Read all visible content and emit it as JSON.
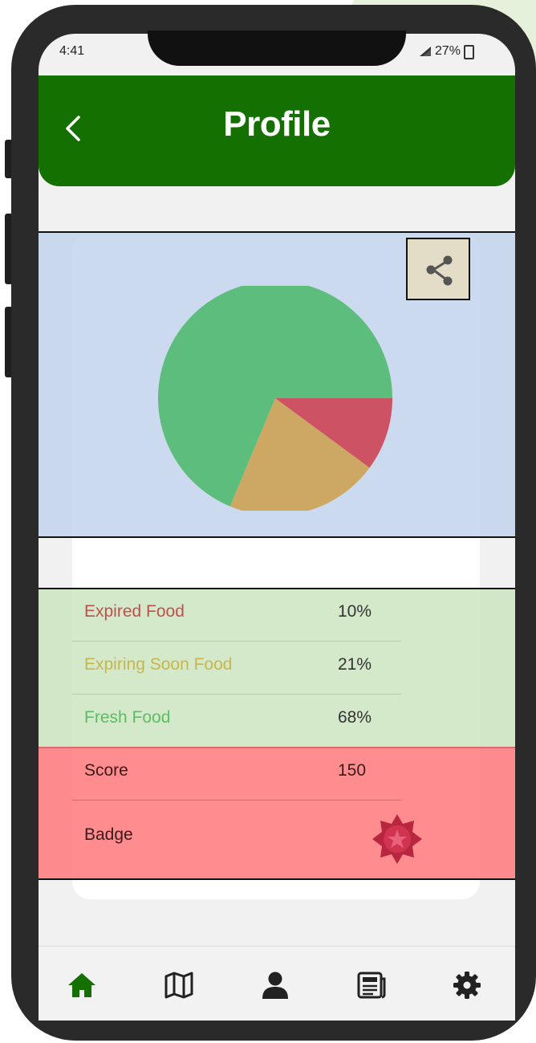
{
  "status_bar": {
    "time": "4:41",
    "battery": "27%"
  },
  "header": {
    "title": "Profile"
  },
  "icons": {
    "back": "chevron-left-icon",
    "share": "share-icon",
    "badge": "badge-seal-icon",
    "nav": [
      "home-icon",
      "map-icon",
      "user-icon",
      "news-icon",
      "gear-icon"
    ]
  },
  "colors": {
    "header": "#147000",
    "expired": "#c9545b",
    "expiring": "#c8a866",
    "fresh": "#5cbd7c",
    "nav_active": "#147000"
  },
  "chart_data": {
    "type": "pie",
    "slices": [
      {
        "label": "Expired Food",
        "value": 10,
        "color": "#cc5264"
      },
      {
        "label": "Expiring Soon Food",
        "value": 21,
        "color": "#cca862"
      },
      {
        "label": "Fresh Food",
        "value": 68,
        "color": "#5cbd7c"
      }
    ]
  },
  "stats": [
    {
      "label": "Expired Food",
      "value": "10%"
    },
    {
      "label": "Expiring Soon Food",
      "value": "21%"
    },
    {
      "label": "Fresh Food",
      "value": "68%"
    }
  ],
  "score": {
    "label": "Score",
    "value": "150"
  },
  "badge": {
    "label": "Badge"
  },
  "nav": {
    "active_index": 0
  }
}
